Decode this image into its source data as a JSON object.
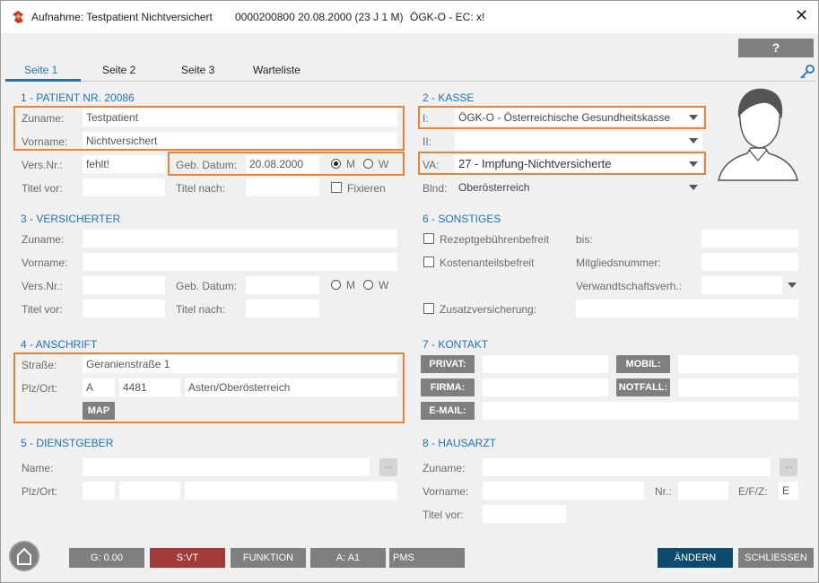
{
  "titlebar": {
    "title": "Aufnahme: Testpatient Nichtversichert",
    "patient_info": "0000200800 20.08.2000 (23 J 1 M)",
    "insurance_info": "ÖGK-O - EC: x!",
    "close_glyph": "✕",
    "logo_icon": "app-logo-icon"
  },
  "help_label": "?",
  "tabs": [
    "Seite 1",
    "Seite 2",
    "Seite 3",
    "Warteliste"
  ],
  "section1": {
    "title": "1 - PATIENT NR. 20086",
    "zuname_label": "Zuname:",
    "zuname_value": "Testpatient",
    "vorname_label": "Vorname:",
    "vorname_value": "Nichtversichert",
    "versnr_label": "Vers.Nr.:",
    "versnr_value": "fehlt!",
    "gebdatum_label": "Geb. Datum:",
    "gebdatum_value": "20.08.2000",
    "gender_m": "M",
    "gender_w": "W",
    "titelvor_label": "Titel vor:",
    "titelnach_label": "Titel nach:",
    "fixieren_label": "Fixieren"
  },
  "section2": {
    "title": "2 - KASSE",
    "i_label": "I:",
    "i_value": "ÖGK-O - Österreichische Gesundheitskasse",
    "ii_label": "II:",
    "va_label": "VA:",
    "va_value": "27 - Impfung-Nichtversicherte",
    "bland_label": "Blnd:",
    "bland_value": "Oberösterreich"
  },
  "section3": {
    "title": "3 - VERSICHERTER",
    "zuname_label": "Zuname:",
    "vorname_label": "Vorname:",
    "versnr_label": "Vers.Nr.:",
    "gebdatum_label": "Geb. Datum:",
    "gender_m": "M",
    "gender_w": "W",
    "titelvor_label": "Titel vor:",
    "titelnach_label": "Titel nach:"
  },
  "section6": {
    "title": "6 - SONSTIGES",
    "rezept_label": "Rezeptgebührenbefreit",
    "bis_label": "bis:",
    "kosten_label": "Kostenanteilsbefreit",
    "mitglied_label": "Mitgliedsnummer:",
    "verwandt_label": "Verwandtschaftsverh.:",
    "zusatz_label": "Zusatzversicherung:"
  },
  "section4": {
    "title": "4 - ANSCHRIFT",
    "strasse_label": "Straße:",
    "strasse_value": "Geranienstraße 1",
    "plzort_label": "Plz/Ort:",
    "country_value": "A",
    "plz_value": "4481",
    "ort_value": "Asten/Oberösterreich",
    "map_label": "MAP"
  },
  "section7": {
    "title": "7 - KONTAKT",
    "privat_label": "PRIVAT:",
    "mobil_label": "MOBIL:",
    "firma_label": "FIRMA:",
    "notfall_label": "NOTFALL:",
    "email_label": "E-MAIL:"
  },
  "section5": {
    "title": "5 - DIENSTGEBER",
    "name_label": "Name:",
    "plzort_label": "Plz/Ort:",
    "dots_label": "..."
  },
  "section8": {
    "title": "8 - HAUSARZT",
    "zuname_label": "Zuname:",
    "vorname_label": "Vorname:",
    "nr_label": "Nr.:",
    "efz_label": "E/F/Z:",
    "efz_value": "E",
    "titelvor_label": "Titel vor:",
    "dots_label": "..."
  },
  "bottom": {
    "g_label": "G: 0.00",
    "s_label": "S:VT",
    "funktion_label": "FUNKTION",
    "a_label": "A: A1",
    "pms_label": "PMS",
    "aendern_label": "ÄNDERN",
    "schliessen_label": "SCHLIESSEN"
  },
  "colors": {
    "accent": "#1e73b4",
    "highlight": "#e8843c",
    "button_gray": "#7f7f7f",
    "s_button": "#a33a3a",
    "aendern_button": "#0e4a6e"
  }
}
